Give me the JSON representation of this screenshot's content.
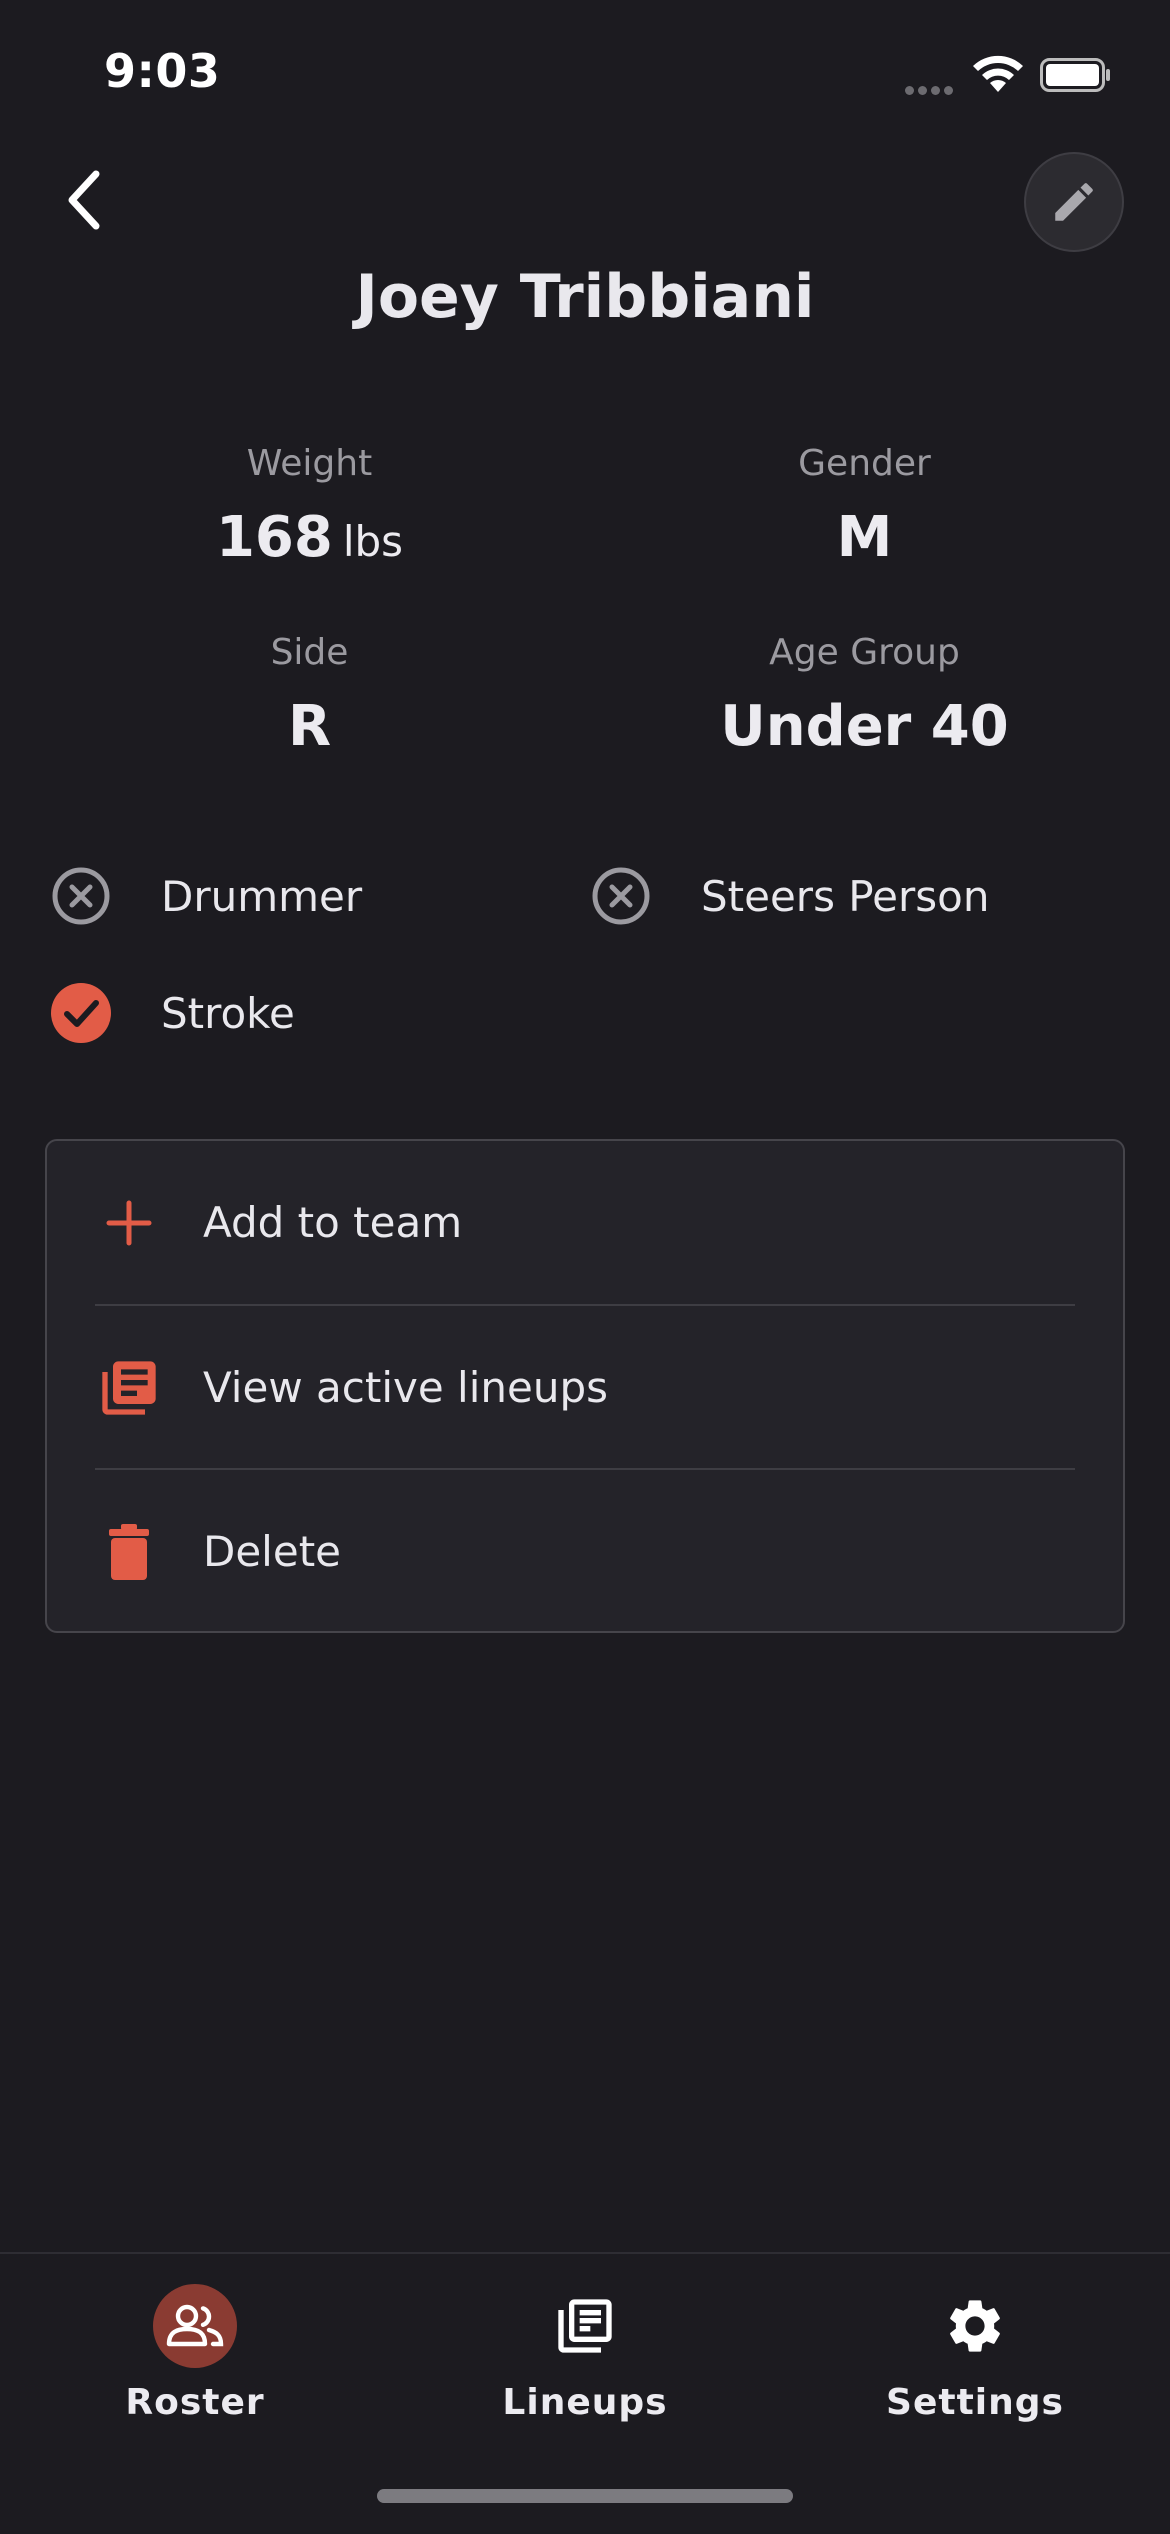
{
  "status_bar": {
    "time": "9:03"
  },
  "header": {
    "player_name": "Joey Tribbiani"
  },
  "stats": {
    "weight": {
      "label": "Weight",
      "value": "168",
      "unit": "lbs"
    },
    "gender": {
      "label": "Gender",
      "value": "M"
    },
    "side": {
      "label": "Side",
      "value": "R"
    },
    "age_group": {
      "label": "Age Group",
      "value": "Under 40"
    }
  },
  "roles": [
    {
      "label": "Drummer",
      "checked": false
    },
    {
      "label": "Steers Person",
      "checked": false
    },
    {
      "label": "Stroke",
      "checked": true
    }
  ],
  "actions": [
    {
      "label": "Add to team",
      "icon": "plus-icon"
    },
    {
      "label": "View active lineups",
      "icon": "lineups-icon"
    },
    {
      "label": "Delete",
      "icon": "trash-icon"
    }
  ],
  "nav": [
    {
      "label": "Roster",
      "icon": "people-icon",
      "active": true
    },
    {
      "label": "Lineups",
      "icon": "lineups-icon",
      "active": false
    },
    {
      "label": "Settings",
      "icon": "gear-icon",
      "active": false
    }
  ],
  "colors": {
    "accent": "#e25c47",
    "background": "#1c1b20",
    "active_pill": "#8a3b32"
  }
}
